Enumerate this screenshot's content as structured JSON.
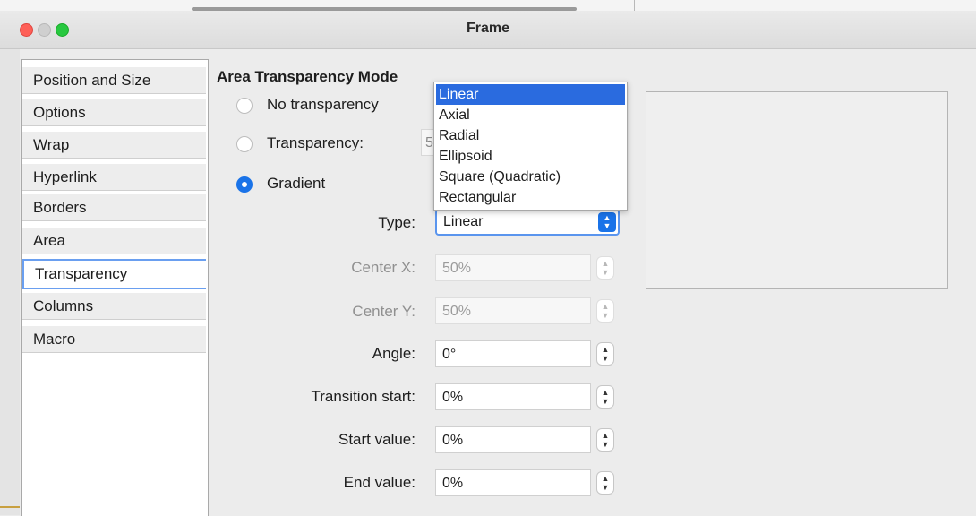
{
  "window": {
    "title": "Frame"
  },
  "sidebar": {
    "items": [
      {
        "label": "Position and Size"
      },
      {
        "label": "Options"
      },
      {
        "label": "Wrap"
      },
      {
        "label": "Hyperlink"
      },
      {
        "label": "Borders"
      },
      {
        "label": "Area"
      },
      {
        "label": "Transparency",
        "selected": true
      },
      {
        "label": "Columns"
      },
      {
        "label": "Macro"
      }
    ]
  },
  "main": {
    "section_title": "Area Transparency Mode",
    "modes": [
      {
        "label": "No transparency",
        "checked": false
      },
      {
        "label": "Transparency:",
        "checked": false
      },
      {
        "label": "Gradient",
        "checked": true
      }
    ],
    "transparency_value_partial": "5",
    "type": {
      "label": "Type:",
      "value": "Linear"
    },
    "fields": [
      {
        "label": "Center X:",
        "value": "50%",
        "enabled": false
      },
      {
        "label": "Center Y:",
        "value": "50%",
        "enabled": false
      },
      {
        "label": "Angle:",
        "value": "0°",
        "enabled": true
      },
      {
        "label": "Transition start:",
        "value": "0%",
        "enabled": true
      },
      {
        "label": "Start value:",
        "value": "0%",
        "enabled": true
      },
      {
        "label": "End value:",
        "value": "0%",
        "enabled": true
      }
    ]
  },
  "dropdown": {
    "options": [
      "Linear",
      "Axial",
      "Radial",
      "Ellipsoid",
      "Square (Quadratic)",
      "Rectangular"
    ],
    "selected": "Linear"
  },
  "colors": {
    "accent": "#1a73e8",
    "highlight": "#2a6bdf",
    "focus": "#5a95ee"
  }
}
